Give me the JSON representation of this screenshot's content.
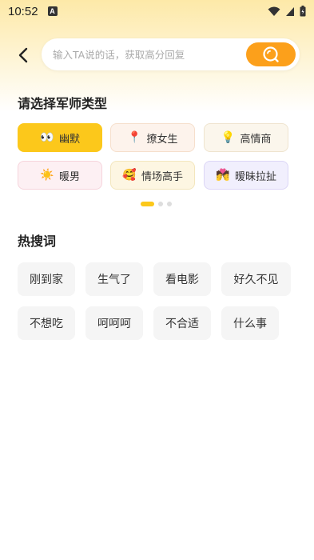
{
  "status_bar": {
    "time": "10:52",
    "badge": "A",
    "icons": [
      "wifi-icon",
      "signal-icon",
      "battery-icon"
    ]
  },
  "search": {
    "placeholder": "输入TA说的话，获取高分回复",
    "button_icon": "search-icon",
    "back_icon": "back-arrow-icon"
  },
  "advisor_section": {
    "title": "请选择军师类型",
    "types": [
      {
        "label": "幽默",
        "emoji": "👀",
        "selected": true
      },
      {
        "label": "撩女生",
        "emoji": "📍",
        "selected": false
      },
      {
        "label": "高情商",
        "emoji": "💡",
        "selected": false
      },
      {
        "label": "暖男",
        "emoji": "☀️",
        "selected": false
      },
      {
        "label": "情场高手",
        "emoji": "🥰",
        "selected": false
      },
      {
        "label": "暧昧拉扯",
        "emoji": "💏",
        "selected": false
      }
    ],
    "pagination": {
      "pages": 3,
      "current": 1
    }
  },
  "hot_section": {
    "title": "热搜词",
    "tags": [
      "刚到家",
      "生气了",
      "看电影",
      "好久不见",
      "不想吃",
      "呵呵呵",
      "不合适",
      "什么事"
    ]
  },
  "colors": {
    "accent": "#fca01b",
    "selected_card": "#fcc81b",
    "card_pink": "#fdf0f3",
    "card_peach": "#fdf3ec",
    "card_cream": "#fbf6ec",
    "card_yellow": "#fdf6e2",
    "card_lavender": "#f1effd"
  }
}
